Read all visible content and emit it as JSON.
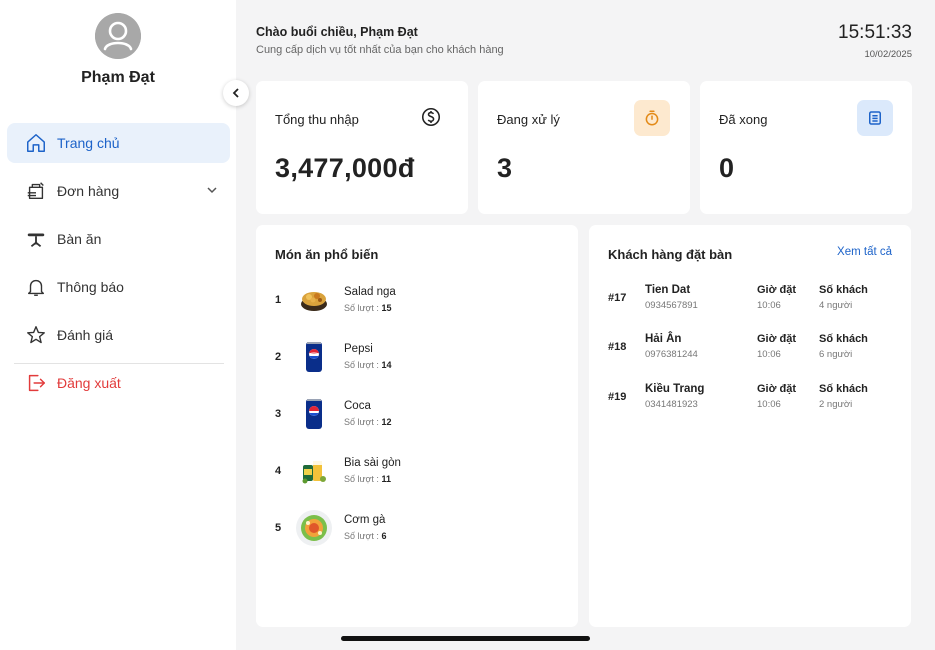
{
  "user": {
    "name": "Phạm Đạt"
  },
  "nav": {
    "items": [
      {
        "label": "Trang chủ",
        "icon": "home-icon"
      },
      {
        "label": "Đơn hàng",
        "icon": "order-icon"
      },
      {
        "label": "Bàn ăn",
        "icon": "table-icon"
      },
      {
        "label": "Thông báo",
        "icon": "bell-icon"
      },
      {
        "label": "Đánh giá",
        "icon": "star-icon"
      }
    ],
    "logout": {
      "label": "Đăng xuất",
      "icon": "logout-icon"
    }
  },
  "header": {
    "greeting": "Chào buổi chiều, Phạm Đạt",
    "subtitle": "Cung cấp dịch vụ tốt nhất của bạn cho khách hàng",
    "time": "15:51:33",
    "date": "10/02/2025"
  },
  "stats": [
    {
      "title": "Tổng thu nhập",
      "value": "3,477,000đ",
      "icon": "dollar-icon"
    },
    {
      "title": "Đang xử lý",
      "value": "3",
      "icon": "timer-icon",
      "icon_bg": "#fde9cf",
      "icon_color": "#e38a18"
    },
    {
      "title": "Đã xong",
      "value": "0",
      "icon": "list-icon",
      "icon_bg": "#dbe9fb",
      "icon_color": "#1d63c9"
    }
  ],
  "popular": {
    "title": "Món ăn phổ biến",
    "count_label": "Số lượt :",
    "items": [
      {
        "rank": "1",
        "name": "Salad nga",
        "count": "15",
        "icon": "salad-bowl-icon"
      },
      {
        "rank": "2",
        "name": "Pepsi",
        "count": "14",
        "icon": "pepsi-can-icon"
      },
      {
        "rank": "3",
        "name": "Coca",
        "count": "12",
        "icon": "soda-can-icon"
      },
      {
        "rank": "4",
        "name": "Bia sài gòn",
        "count": "11",
        "icon": "beer-icon"
      },
      {
        "rank": "5",
        "name": "Cơm gà",
        "count": "6",
        "icon": "rice-plate-icon"
      }
    ]
  },
  "bookings": {
    "title": "Khách hàng đặt bàn",
    "see_all": "Xem tất cả",
    "time_label": "Giờ đặt",
    "guests_label": "Số khách",
    "items": [
      {
        "id": "#17",
        "name": "Tien Dat",
        "phone": "0934567891",
        "time": "10:06",
        "guests": "4 người"
      },
      {
        "id": "#18",
        "name": "Hải Ân",
        "phone": "0976381244",
        "time": "10:06",
        "guests": "6 người"
      },
      {
        "id": "#19",
        "name": "Kiều Trang",
        "phone": "0341481923",
        "time": "10:06",
        "guests": "2 người"
      }
    ]
  },
  "colors": {
    "accent": "#1d63c9",
    "active_bg": "#e9f1fb",
    "logout": "#e23b3b"
  }
}
